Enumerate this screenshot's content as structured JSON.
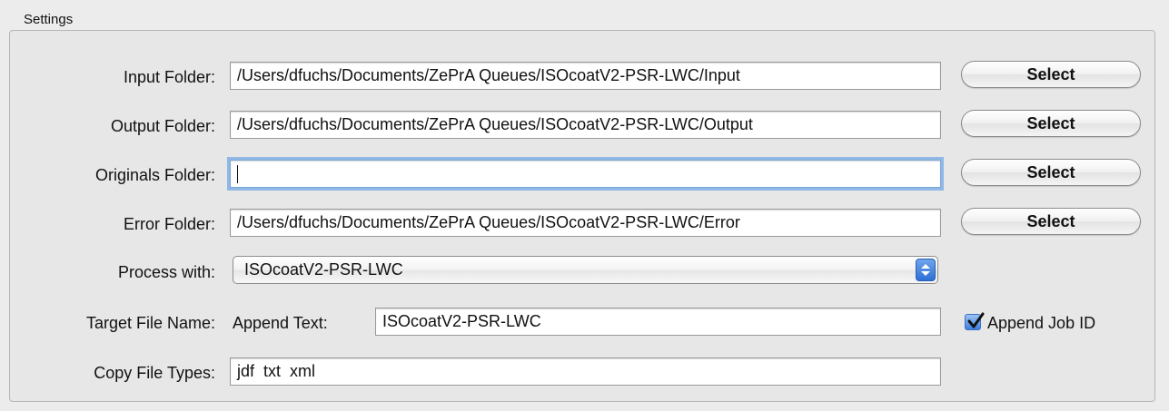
{
  "group": {
    "title": "Settings"
  },
  "input_folder": {
    "label": "Input Folder:",
    "value": "/Users/dfuchs/Documents/ZePrA Queues/ISOcoatV2-PSR-LWC/Input",
    "button": "Select"
  },
  "output_folder": {
    "label": "Output Folder:",
    "value": "/Users/dfuchs/Documents/ZePrA Queues/ISOcoatV2-PSR-LWC/Output",
    "button": "Select"
  },
  "originals_folder": {
    "label": "Originals Folder:",
    "value": "",
    "button": "Select"
  },
  "error_folder": {
    "label": "Error Folder:",
    "value": "/Users/dfuchs/Documents/ZePrA Queues/ISOcoatV2-PSR-LWC/Error",
    "button": "Select"
  },
  "process_with": {
    "label": "Process with:",
    "selected": "ISOcoatV2-PSR-LWC"
  },
  "target_file_name": {
    "label": "Target File Name:",
    "append_text_label": "Append Text:",
    "append_text_value": "ISOcoatV2-PSR-LWC",
    "append_job_id_label": "Append Job ID",
    "append_job_id_checked": true
  },
  "copy_file_types": {
    "label": "Copy File Types:",
    "value": "jdf  txt  xml"
  }
}
